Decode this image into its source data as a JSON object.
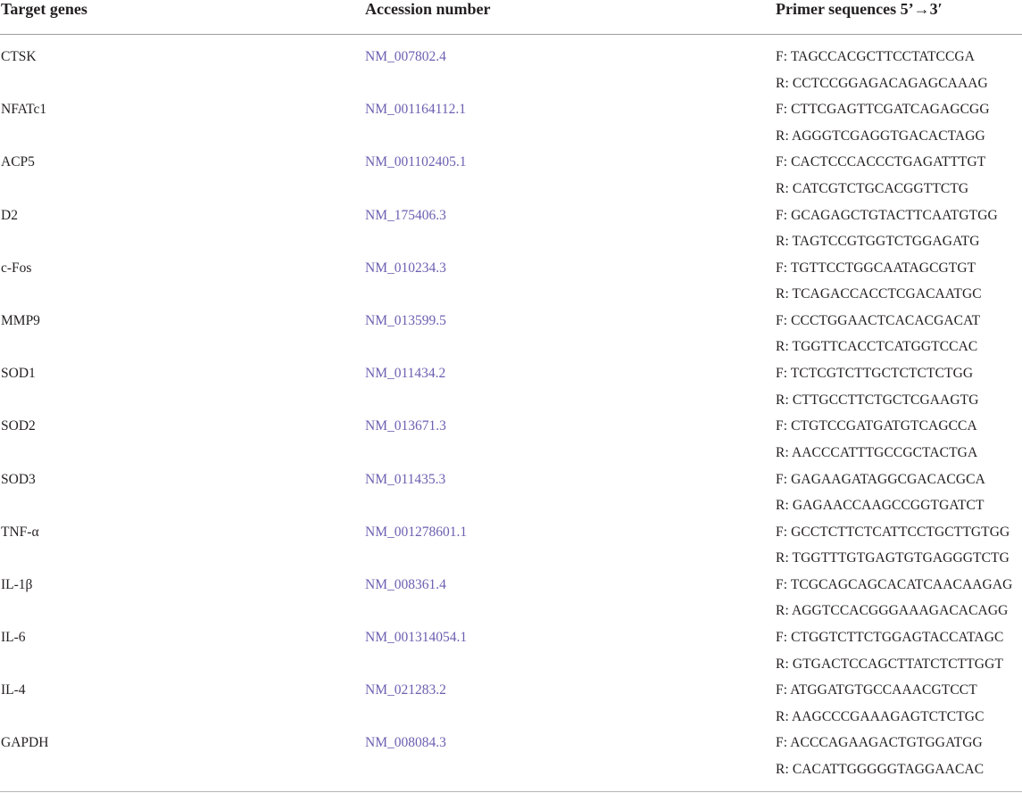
{
  "table": {
    "headers": {
      "gene": "Target genes",
      "accession": "Accession number",
      "primer": "Primer sequences 5’→3′"
    },
    "rows": [
      {
        "gene": "CTSK",
        "accession": "NM_007802.4",
        "forward": "F: TAGCCACGCTTCCTATCCGA",
        "reverse": "R: CCTCCGGAGACAGAGCAAAG"
      },
      {
        "gene": "NFATc1",
        "accession": "NM_001164112.1",
        "forward": "F: CTTCGAGTTCGATCAGAGCGG",
        "reverse": "R: AGGGTCGAGGTGACACTAGG"
      },
      {
        "gene": "ACP5",
        "accession": "NM_001102405.1",
        "forward": "F: CACTCCCACCCTGAGATTTGT",
        "reverse": "R: CATCGTCTGCACGGTTCTG"
      },
      {
        "gene": "D2",
        "accession": "NM_175406.3",
        "forward": "F: GCAGAGCTGTACTTCAATGTGG",
        "reverse": "R: TAGTCCGTGGTCTGGAGATG"
      },
      {
        "gene": "c-Fos",
        "accession": "NM_010234.3",
        "forward": "F: TGTTCCTGGCAATAGCGTGT",
        "reverse": "R: TCAGACCACCTCGACAATGC"
      },
      {
        "gene": "MMP9",
        "accession": "NM_013599.5",
        "forward": "F: CCCTGGAACTCACACGACAT",
        "reverse": "R: TGGTTCACCTCATGGTCCAC"
      },
      {
        "gene": "SOD1",
        "accession": "NM_011434.2",
        "forward": "F: TCTCGTCTTGCTCTCTCTGG",
        "reverse": "R: CTTGCCTTCTGCTCGAAGTG"
      },
      {
        "gene": "SOD2",
        "accession": "NM_013671.3",
        "forward": "F: CTGTCCGATGATGTCAGCCA",
        "reverse": "R: AACCCATTTGCCGCTACTGA"
      },
      {
        "gene": "SOD3",
        "accession": "NM_011435.3",
        "forward": "F: GAGAAGATAGGCGACACGCA",
        "reverse": "R: GAGAACCAAGCCGGTGATCT"
      },
      {
        "gene": "TNF-α",
        "accession": "NM_001278601.1",
        "forward": "F: GCCTCTTCTCATTCCTGCTTGTGG",
        "reverse": "R: TGGTTTGTGAGTGTGAGGGTCTG"
      },
      {
        "gene": "IL-1β",
        "accession": "NM_008361.4",
        "forward": "F: TCGCAGCAGCACATCAACAAGAG",
        "reverse": "R: AGGTCCACGGGAAAGACACAGG"
      },
      {
        "gene": "IL-6",
        "accession": "NM_001314054.1",
        "forward": "F: CTGGTCTTCTGGAGTACCATAGC",
        "reverse": "R: GTGACTCCAGCTTATCTCTTGGT"
      },
      {
        "gene": "IL-4",
        "accession": "NM_021283.2",
        "forward": "F: ATGGATGTGCCAAACGTCCT",
        "reverse": "R: AAGCCCGAAAGAGTCTCTGC"
      },
      {
        "gene": "GAPDH",
        "accession": "NM_008084.3",
        "forward": "F: ACCCAGAAGACTGTGGATGG",
        "reverse": "R: CACATTGGGGGTAGGAACAC"
      }
    ]
  },
  "colors": {
    "text": "#231f20",
    "link": "#6b5fb0",
    "rule": "#9e9e9e"
  }
}
